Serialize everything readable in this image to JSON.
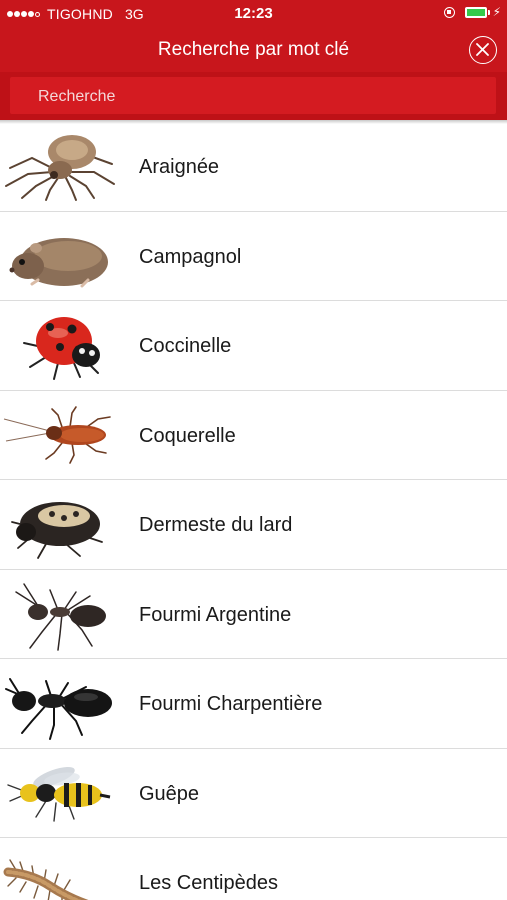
{
  "status_bar": {
    "carrier": "TIGOHND",
    "network": "3G",
    "time": "12:23"
  },
  "nav": {
    "title": "Recherche par mot clé"
  },
  "search": {
    "placeholder": "Recherche"
  },
  "colors": {
    "brand_red": "#c8161c",
    "battery_green": "#35c94a"
  },
  "items": [
    {
      "label": "Araignée",
      "icon": "spider-icon"
    },
    {
      "label": "Campagnol",
      "icon": "vole-icon"
    },
    {
      "label": "Coccinelle",
      "icon": "ladybug-icon"
    },
    {
      "label": "Coquerelle",
      "icon": "cockroach-icon"
    },
    {
      "label": "Dermeste du lard",
      "icon": "larder-beetle-icon"
    },
    {
      "label": "Fourmi Argentine",
      "icon": "argentine-ant-icon"
    },
    {
      "label": "Fourmi Charpentière",
      "icon": "carpenter-ant-icon"
    },
    {
      "label": "Guêpe",
      "icon": "wasp-icon"
    },
    {
      "label": "Les Centipèdes",
      "icon": "centipede-icon"
    }
  ]
}
